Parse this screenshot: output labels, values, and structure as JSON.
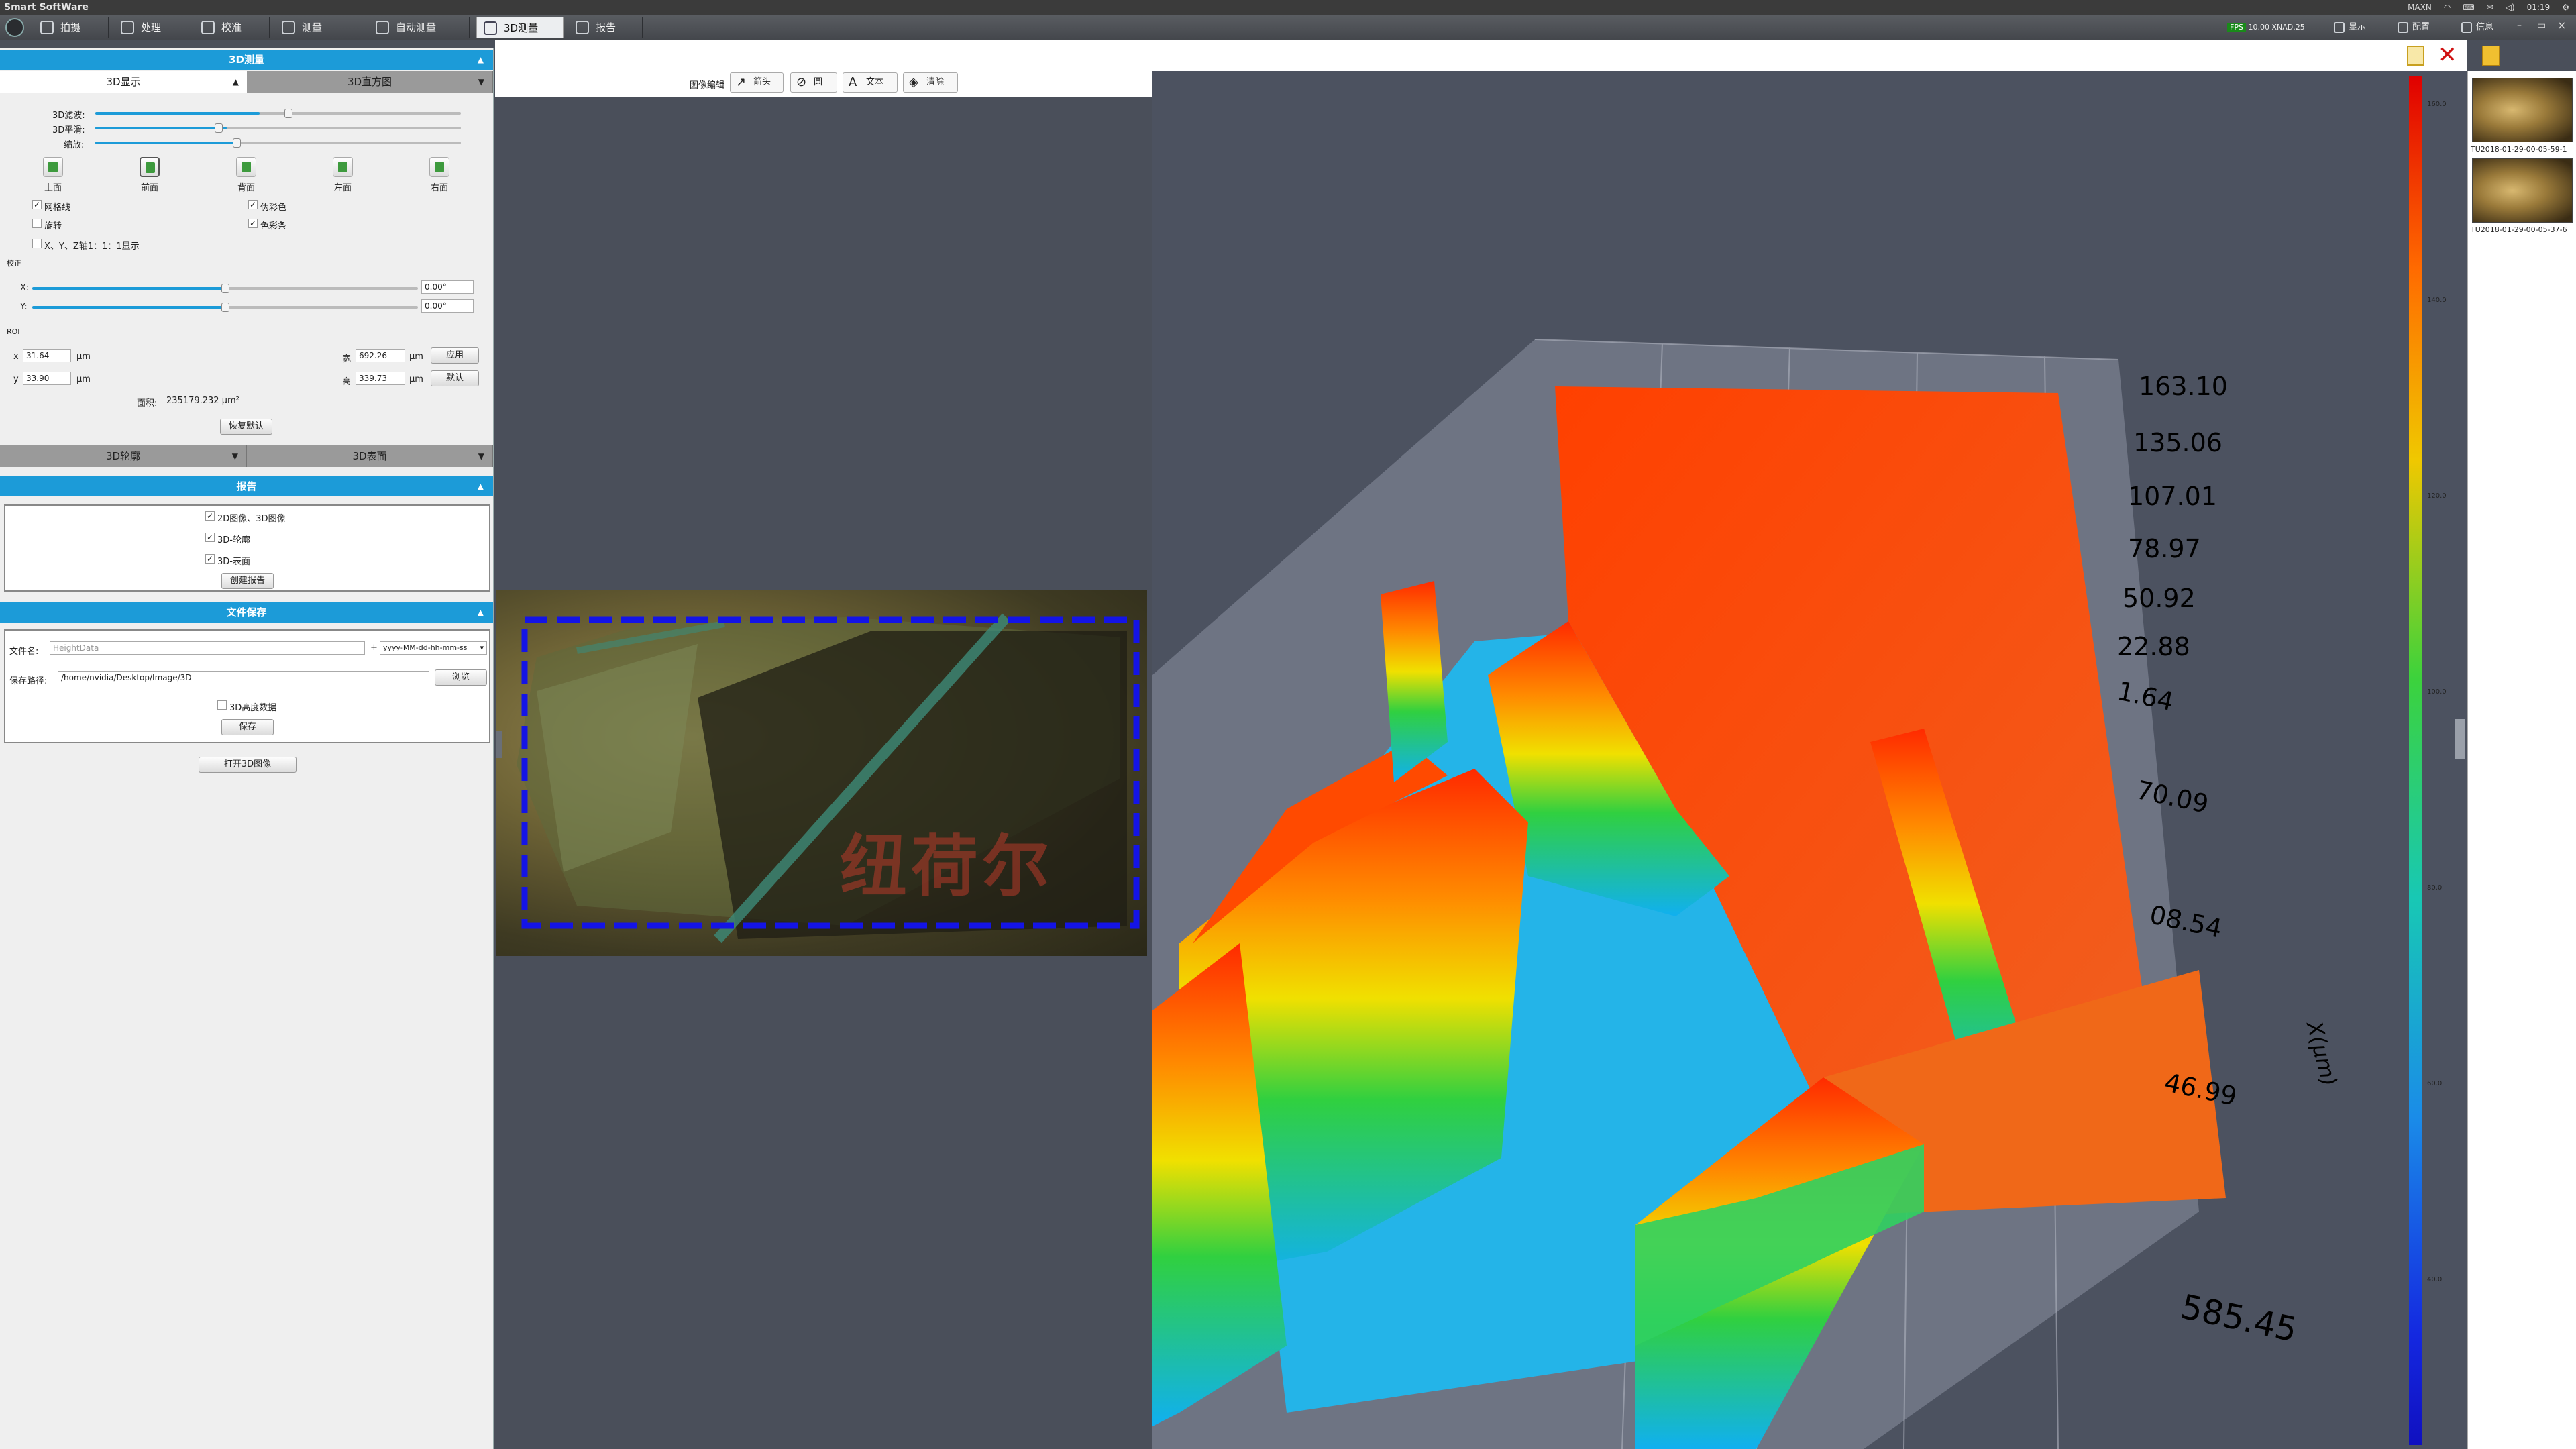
{
  "app_title": "Smart SoftWare",
  "system_status": {
    "nvidia": "MAXN",
    "time": "01:19"
  },
  "toolbar": {
    "tabs": [
      {
        "label": "拍摄"
      },
      {
        "label": "处理"
      },
      {
        "label": "校准"
      },
      {
        "label": "测量"
      },
      {
        "label": "自动测量"
      },
      {
        "label": "3D测量"
      },
      {
        "label": "报告"
      }
    ],
    "right": {
      "stat_fps": "10.00",
      "stat_res": "XNAD.25",
      "display": "显示",
      "config": "配置",
      "info": "信息"
    }
  },
  "left": {
    "section_3d": "3D测量",
    "tab_display": "3D显示",
    "tab_histogram": "3D直方图",
    "sliders": [
      {
        "label": "3D滤波:",
        "value": 0.45
      },
      {
        "label": "3D平滑:",
        "value": 0.3
      },
      {
        "label": "缩放:",
        "value": 0.35
      }
    ],
    "views": [
      "上面",
      "前面",
      "背面",
      "左面",
      "右面"
    ],
    "checks": {
      "grid": "网格线",
      "pseudocolor": "伪彩色",
      "rotate": "旋转",
      "colorbar": "色彩条",
      "xyz_ratio": "X、Y、Z轴1：1：1显示"
    },
    "calib_title": "校正",
    "calib_x_label": "X:",
    "calib_x_value": "0.00°",
    "calib_y_label": "Y:",
    "calib_y_value": "0.00°",
    "roi_title": "ROI",
    "roi": {
      "x_label": "x",
      "x": "31.64",
      "y_label": "y",
      "y": "33.90",
      "unit": "μm",
      "w_label": "宽",
      "w": "692.26",
      "h_label": "高",
      "h": "339.73",
      "apply": "应用",
      "default": "默认",
      "area_label": "面积:",
      "area": "235179.232 μm²",
      "reset": "恢复默认"
    },
    "tab_contour": "3D轮廓",
    "tab_surface": "3D表面",
    "section_report": "报告",
    "report_checks": [
      "2D图像、3D图像",
      "3D-轮廓",
      "3D-表面"
    ],
    "create_report": "创建报告",
    "section_save": "文件保存",
    "filename_label": "文件名:",
    "filename_placeholder": "HeightData",
    "plus": "+",
    "date_format": "yyyy-MM-dd-hh-mm-ss",
    "savepath_label": "保存路径:",
    "savepath": "/home/nvidia/Desktop/Image/3D",
    "browse": "浏览",
    "height_data": "3D高度数据",
    "save": "保存",
    "open3d": "打开3D图像"
  },
  "editbar": {
    "label": "图像编辑",
    "arrow": "箭头",
    "circle": "圆",
    "text": "文本",
    "clear": "清除"
  },
  "image_watermark": "纽荷尔",
  "view3d": {
    "axis_labels": [
      "163.10",
      "135.06",
      "107.01",
      "78.97",
      "50.92",
      "22.88",
      "1.64",
      "70.09",
      "08.54",
      "46.99",
      "585.45"
    ],
    "axis_title": "X(μm)",
    "colorbar_ticks": [
      "160.0",
      "140.0",
      "120.0",
      "100.0",
      "80.0",
      "60.0",
      "40.0"
    ]
  },
  "thumbnails": [
    {
      "label": "TU2018-01-29-00-05-59-1"
    },
    {
      "label": "TU2018-01-29-00-05-37-6"
    }
  ]
}
